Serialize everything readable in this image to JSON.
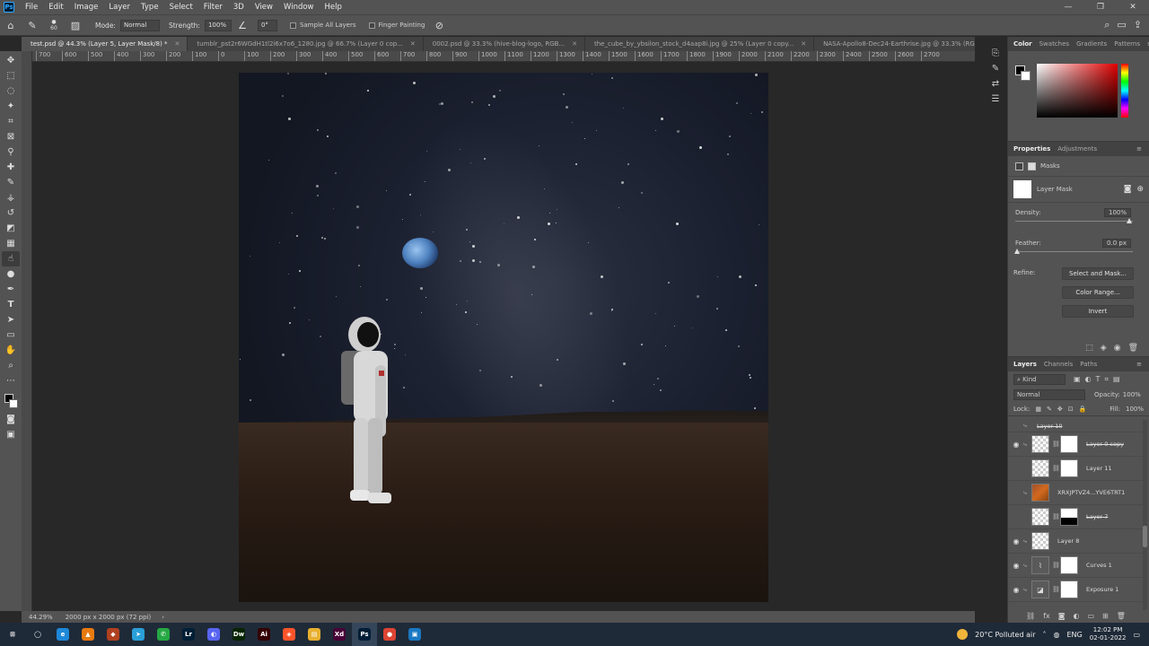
{
  "app": {
    "logo": "Ps"
  },
  "menu": [
    "File",
    "Edit",
    "Image",
    "Layer",
    "Type",
    "Select",
    "Filter",
    "3D",
    "View",
    "Window",
    "Help"
  ],
  "options": {
    "brush_size": "60",
    "mode_label": "Mode:",
    "mode_value": "Normal",
    "strength_label": "Strength:",
    "strength_value": "100%",
    "angle_value": "0°",
    "sample_all_layers": "Sample All Layers",
    "finger_painting": "Finger Painting"
  },
  "tabs": [
    {
      "label": "test.psd @ 44.3% (Layer 5, Layer Mask/8) *"
    },
    {
      "label": "tumblr_pst2r6WGdH1tl2i6x7o6_1280.jpg @ 66.7% (Layer 0 cop..."
    },
    {
      "label": "0002.psd @ 33.3% (hive-blog-logo, RGB..."
    },
    {
      "label": "the_cube_by_ybsilon_stock_d4aap8i.jpg @ 25% (Layer 0 copy..."
    },
    {
      "label": "NASA-Apollo8-Dec24-Earthrise.jpg @ 33.3% (RGB..."
    }
  ],
  "ruler_ticks": [
    "700",
    "600",
    "500",
    "400",
    "300",
    "200",
    "100",
    "0",
    "100",
    "200",
    "300",
    "400",
    "500",
    "600",
    "700",
    "800",
    "900",
    "1000",
    "1100",
    "1200",
    "1300",
    "1400",
    "1500",
    "1600",
    "1700",
    "1800",
    "1900",
    "2000",
    "2100",
    "2200",
    "2300",
    "2400",
    "2500",
    "2600",
    "2700"
  ],
  "status": {
    "zoom": "44.29%",
    "doc_size": "2000 px x 2000 px (72 ppi)"
  },
  "color_panel": {
    "tabs": [
      "Color",
      "Swatches",
      "Gradients",
      "Patterns"
    ]
  },
  "properties": {
    "tabs": [
      "Properties",
      "Adjustments"
    ],
    "section": "Masks",
    "layer_mask": "Layer Mask",
    "density_label": "Density:",
    "density_value": "100%",
    "feather_label": "Feather:",
    "feather_value": "0.0 px",
    "refine_label": "Refine:",
    "btn_select_mask": "Select and Mask...",
    "btn_color_range": "Color Range...",
    "btn_invert": "Invert"
  },
  "layers": {
    "tabs": [
      "Layers",
      "Channels",
      "Paths"
    ],
    "kind": "Kind",
    "blend": "Normal",
    "opacity_label": "Opacity:",
    "opacity_value": "100%",
    "lock_label": "Lock:",
    "fill_label": "Fill:",
    "fill_value": "100%",
    "partial_name": "Layer 10",
    "rows": [
      {
        "name": "Layer 0 copy",
        "visible": true,
        "strike": true
      },
      {
        "name": "Layer 11",
        "visible": false,
        "strike": false
      },
      {
        "name": "XRXJPTVZ4...YVE6TRT1",
        "visible": false,
        "strike": false
      },
      {
        "name": "Layer 7",
        "visible": false,
        "strike": true
      },
      {
        "name": "Layer 8",
        "visible": true,
        "strike": false
      },
      {
        "name": "Curves 1",
        "visible": true,
        "strike": false
      },
      {
        "name": "Exposure 1",
        "visible": true,
        "strike": false
      }
    ]
  },
  "taskbar": {
    "weather": "20°C  Polluted air",
    "lang": "ENG",
    "time": "12:02 PM",
    "date": "02-01-2022",
    "apps": [
      {
        "name": "windows-start",
        "glyph": "⊞",
        "color": "#1f2a38"
      },
      {
        "name": "search",
        "glyph": "◯",
        "color": "#1f2a38"
      },
      {
        "name": "edge",
        "glyph": "e",
        "color": "#1e88d8"
      },
      {
        "name": "vlc",
        "glyph": "▲",
        "color": "#e87a10"
      },
      {
        "name": "app-red",
        "glyph": "◆",
        "color": "#b04020"
      },
      {
        "name": "telegram",
        "glyph": "➤",
        "color": "#2a9fd8"
      },
      {
        "name": "whatsapp",
        "glyph": "✆",
        "color": "#25a844"
      },
      {
        "name": "lightroom",
        "glyph": "Lr",
        "color": "#001e36"
      },
      {
        "name": "discord",
        "glyph": "◐",
        "color": "#5865f2"
      },
      {
        "name": "dreamweaver",
        "glyph": "Dw",
        "color": "#072401"
      },
      {
        "name": "illustrator",
        "glyph": "Ai",
        "color": "#330000"
      },
      {
        "name": "brave",
        "glyph": "◈",
        "color": "#fb542b"
      },
      {
        "name": "file-explorer",
        "glyph": "▤",
        "color": "#e8b030"
      },
      {
        "name": "xd",
        "glyph": "Xd",
        "color": "#470137"
      },
      {
        "name": "photoshop",
        "glyph": "Ps",
        "color": "#001e36"
      },
      {
        "name": "chrome",
        "glyph": "●",
        "color": "#dd4433"
      },
      {
        "name": "photos",
        "glyph": "▣",
        "color": "#1a78c2"
      }
    ]
  }
}
